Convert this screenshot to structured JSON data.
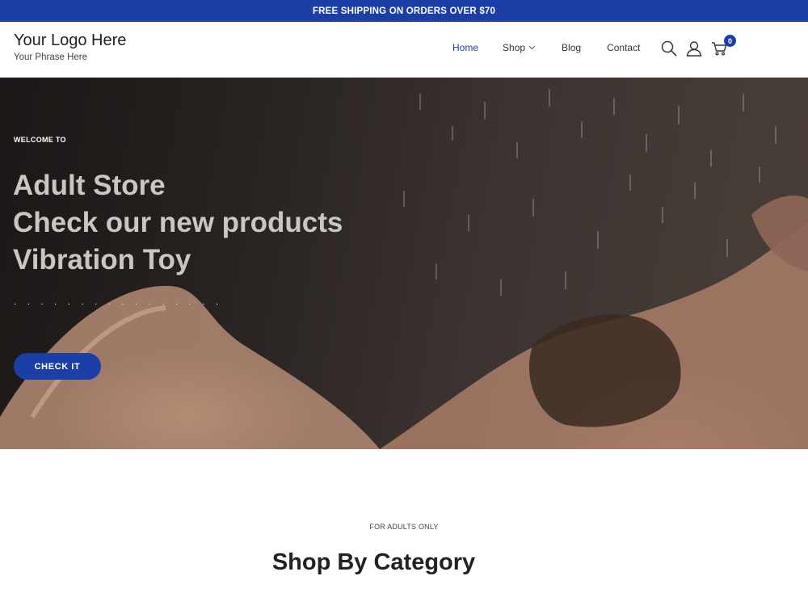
{
  "announcement": {
    "text": "FREE SHIPPING ON ORDERS OVER $70"
  },
  "brand": {
    "title": "Your Logo Here",
    "phrase": "Your Phrase Here"
  },
  "nav": {
    "items": [
      {
        "label": "Home",
        "active": true
      },
      {
        "label": "Shop",
        "has_dropdown": true
      },
      {
        "label": "Blog"
      },
      {
        "label": "Contact"
      }
    ]
  },
  "header_icons": {
    "search": "search-icon",
    "account": "user-icon",
    "cart": "cart-icon",
    "cart_count": "0"
  },
  "hero": {
    "welcome": "WELCOME TO",
    "lines": [
      "Adult Store",
      "Check our new products",
      "Vibration Toy"
    ],
    "dots": ". . . . . . . . . . . . . . . .",
    "cta_label": "CHECK IT"
  },
  "section": {
    "kicker": "FOR ADULTS ONLY",
    "title": "Shop By Category"
  },
  "colors": {
    "brand_blue": "#1b3fa6",
    "hero_text": "#c9c6c4"
  }
}
